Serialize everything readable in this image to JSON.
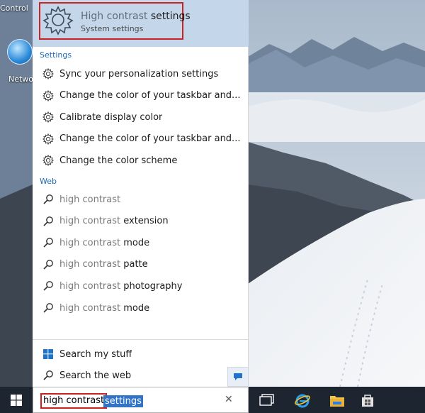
{
  "desktop": {
    "icon_top_label": "Control",
    "icon_network_label": "Netwo"
  },
  "search": {
    "best_match": {
      "title_hint": "High contrast",
      "title_rest": "settings",
      "subtitle": "System settings",
      "icon": "gear-icon"
    },
    "settings_header": "Settings",
    "settings_items": [
      {
        "label": "Sync your personalization settings",
        "icon": "gear-icon"
      },
      {
        "label": "Change the color of your taskbar and...",
        "icon": "gear-icon"
      },
      {
        "label": "Calibrate display color",
        "icon": "gear-icon"
      },
      {
        "label": "Change the color of your taskbar and...",
        "icon": "gear-icon"
      },
      {
        "label": "Change the color scheme",
        "icon": "gear-icon"
      }
    ],
    "web_header": "Web",
    "web_items": [
      {
        "hint": "high contrast",
        "rest": "",
        "icon": "search-icon"
      },
      {
        "hint": "high contrast",
        "rest": "extension",
        "icon": "search-icon"
      },
      {
        "hint": "high contrast",
        "rest": "mode",
        "icon": "search-icon"
      },
      {
        "hint": "high contrast",
        "rest": "patte",
        "icon": "search-icon"
      },
      {
        "hint": "high contrast",
        "rest": "photography",
        "icon": "search-icon"
      },
      {
        "hint": "high contrast",
        "rest": "mode",
        "icon": "search-icon"
      }
    ],
    "footer": {
      "my_stuff_label": "Search my stuff",
      "web_label": "Search the web"
    },
    "query_typed": "high contrast",
    "query_autocomplete": "settings"
  },
  "taskbar": {
    "apps": [
      "task-view-icon",
      "internet-explorer-icon",
      "file-explorer-icon",
      "store-icon"
    ]
  },
  "colors": {
    "highlight_box": "#cc2222",
    "best_match_bg": "#c3d6ea",
    "section_header": "#1c6bb7",
    "taskbar_bg": "#1d2531",
    "selection_bg": "#3173c5"
  }
}
